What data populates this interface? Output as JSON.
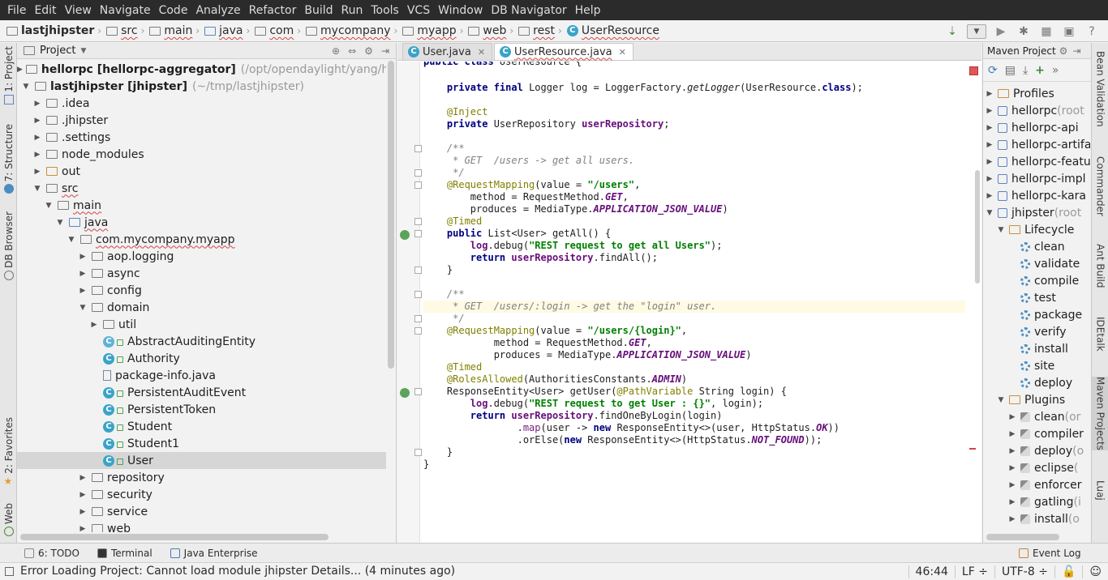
{
  "menu": [
    "File",
    "Edit",
    "View",
    "Navigate",
    "Code",
    "Analyze",
    "Refactor",
    "Build",
    "Run",
    "Tools",
    "VCS",
    "Window",
    "DB Navigator",
    "Help"
  ],
  "breadcrumbs": [
    {
      "label": "lastjhipster",
      "icon": "folder-icon"
    },
    {
      "label": "src",
      "icon": "folder-icon"
    },
    {
      "label": "main",
      "icon": "folder-icon"
    },
    {
      "label": "java",
      "icon": "folder-icon"
    },
    {
      "label": "com",
      "icon": "folder-icon"
    },
    {
      "label": "mycompany",
      "icon": "folder-icon"
    },
    {
      "label": "myapp",
      "icon": "folder-icon"
    },
    {
      "label": "web",
      "icon": "folder-icon"
    },
    {
      "label": "rest",
      "icon": "folder-icon"
    },
    {
      "label": "UserResource",
      "icon": "class-icon"
    }
  ],
  "left_tabs": [
    "1: Project",
    "7: Structure",
    "DB Browser",
    "2: Favorites",
    "Web"
  ],
  "right_tabs": [
    "Bean Validation",
    "Commander",
    "Ant Build",
    "IDEtalk",
    "Maven Projects",
    "Luaj"
  ],
  "project": {
    "title": "Project",
    "rows": [
      {
        "label": "hellorpc [hellorpc-aggregator]",
        "hint": "(/opt/opendaylight/yang/hellorp",
        "arrow": "▶",
        "icon": "module",
        "bold": true
      },
      {
        "label": "lastjhipster [jhipster]",
        "hint": "(~/tmp/lastjhipster)",
        "arrow": "▼",
        "icon": "module",
        "bold": true
      },
      {
        "label": ".idea",
        "arrow": "▶",
        "icon": "folder"
      },
      {
        "label": ".jhipster",
        "arrow": "▶",
        "icon": "folder"
      },
      {
        "label": ".settings",
        "arrow": "▶",
        "icon": "folder"
      },
      {
        "label": "node_modules",
        "arrow": "▶",
        "icon": "folder"
      },
      {
        "label": "out",
        "arrow": "▶",
        "icon": "folder-orange"
      },
      {
        "label": "src",
        "arrow": "▼",
        "icon": "folder",
        "wavy": true
      },
      {
        "label": "main",
        "arrow": "▼",
        "icon": "folder",
        "wavy": true
      },
      {
        "label": "java",
        "arrow": "▼",
        "icon": "folder-blue",
        "wavy": true
      },
      {
        "label": "com.mycompany.myapp",
        "arrow": "▼",
        "icon": "folder",
        "wavy": true
      },
      {
        "label": "aop.logging",
        "arrow": "▶",
        "icon": "folder"
      },
      {
        "label": "async",
        "arrow": "▶",
        "icon": "folder"
      },
      {
        "label": "config",
        "arrow": "▶",
        "icon": "folder"
      },
      {
        "label": "domain",
        "arrow": "▼",
        "icon": "folder"
      },
      {
        "label": "util",
        "arrow": "▶",
        "icon": "folder"
      },
      {
        "label": "AbstractAuditingEntity",
        "arrow": "",
        "icon": "class-abstract"
      },
      {
        "label": "Authority",
        "arrow": "",
        "icon": "class"
      },
      {
        "label": "package-info.java",
        "arrow": "",
        "icon": "file"
      },
      {
        "label": "PersistentAuditEvent",
        "arrow": "",
        "icon": "class"
      },
      {
        "label": "PersistentToken",
        "arrow": "",
        "icon": "class"
      },
      {
        "label": "Student",
        "arrow": "",
        "icon": "class"
      },
      {
        "label": "Student1",
        "arrow": "",
        "icon": "class"
      },
      {
        "label": "User",
        "arrow": "",
        "icon": "class",
        "selected": true
      },
      {
        "label": "repository",
        "arrow": "▶",
        "icon": "folder"
      },
      {
        "label": "security",
        "arrow": "▶",
        "icon": "folder"
      },
      {
        "label": "service",
        "arrow": "▶",
        "icon": "folder"
      },
      {
        "label": "web",
        "arrow": "▶",
        "icon": "folder"
      }
    ]
  },
  "editor": {
    "tabs": [
      {
        "label": "User.java",
        "active": false
      },
      {
        "label": "UserResource.java",
        "active": true
      }
    ]
  },
  "maven": {
    "title": "Maven Project",
    "rows": [
      {
        "label": "Profiles",
        "hint": "",
        "arrow": "▶",
        "icon": "fold"
      },
      {
        "label": "hellorpc",
        "hint": " (root",
        "arrow": "▶",
        "icon": "mod"
      },
      {
        "label": "hellorpc-api",
        "hint": "",
        "arrow": "▶",
        "icon": "mod"
      },
      {
        "label": "hellorpc-artifa",
        "hint": "",
        "arrow": "▶",
        "icon": "mod"
      },
      {
        "label": "hellorpc-featu",
        "hint": "",
        "arrow": "▶",
        "icon": "mod"
      },
      {
        "label": "hellorpc-impl",
        "hint": "",
        "arrow": "▶",
        "icon": "mod"
      },
      {
        "label": "hellorpc-kara",
        "hint": "",
        "arrow": "▶",
        "icon": "mod"
      },
      {
        "label": "jhipster",
        "hint": " (root",
        "arrow": "▼",
        "icon": "mod"
      },
      {
        "label": "Lifecycle",
        "hint": "",
        "arrow": "▼",
        "icon": "fold"
      },
      {
        "label": "clean",
        "hint": "",
        "arrow": "",
        "icon": "gear"
      },
      {
        "label": "validate",
        "hint": "",
        "arrow": "",
        "icon": "gear"
      },
      {
        "label": "compile",
        "hint": "",
        "arrow": "",
        "icon": "gear"
      },
      {
        "label": "test",
        "hint": "",
        "arrow": "",
        "icon": "gear"
      },
      {
        "label": "package",
        "hint": "",
        "arrow": "",
        "icon": "gear"
      },
      {
        "label": "verify",
        "hint": "",
        "arrow": "",
        "icon": "gear"
      },
      {
        "label": "install",
        "hint": "",
        "arrow": "",
        "icon": "gear"
      },
      {
        "label": "site",
        "hint": "",
        "arrow": "",
        "icon": "gear"
      },
      {
        "label": "deploy",
        "hint": "",
        "arrow": "",
        "icon": "gear"
      },
      {
        "label": "Plugins",
        "hint": "",
        "arrow": "▼",
        "icon": "fold"
      },
      {
        "label": "clean",
        "hint": " (or",
        "arrow": "▶",
        "icon": "plug"
      },
      {
        "label": "compiler",
        "hint": "",
        "arrow": "▶",
        "icon": "plug"
      },
      {
        "label": "deploy",
        "hint": " (o",
        "arrow": "▶",
        "icon": "plug"
      },
      {
        "label": "eclipse",
        "hint": " (",
        "arrow": "▶",
        "icon": "plug"
      },
      {
        "label": "enforcer",
        "hint": "",
        "arrow": "▶",
        "icon": "plug"
      },
      {
        "label": "gatling",
        "hint": " (i",
        "arrow": "▶",
        "icon": "plug"
      },
      {
        "label": "install",
        "hint": " (o",
        "arrow": "▶",
        "icon": "plug"
      }
    ]
  },
  "toolwindows": [
    "6: TODO",
    "Terminal",
    "Java Enterprise",
    "Event Log"
  ],
  "status": {
    "message": "Error Loading Project: Cannot load module jhipster Details... (4 minutes ago)",
    "position": "46:44",
    "line_sep": "LF ÷",
    "encoding": "UTF-8 ÷"
  }
}
